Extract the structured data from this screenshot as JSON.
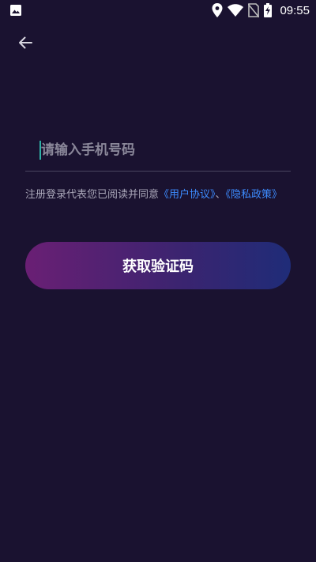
{
  "status_bar": {
    "time": "09:55",
    "icons": [
      "image-icon",
      "location-icon",
      "wifi-icon",
      "no-sim-icon",
      "battery-charging-icon"
    ]
  },
  "header": {
    "back_icon": "arrow-left-icon"
  },
  "form": {
    "phone_placeholder": "请输入手机号码",
    "phone_value": ""
  },
  "agreement": {
    "prefix": "注册登录代表您已阅读并同意",
    "user_agreement": "《用户协议》",
    "separator": "、",
    "privacy_policy": "《隐私政策》"
  },
  "actions": {
    "get_code_label": "获取验证码"
  },
  "colors": {
    "background": "#1a1230",
    "link": "#3d8cff",
    "button_gradient_start": "#6a1f74",
    "button_gradient_end": "#1f2c78",
    "caret": "#2fb0a5"
  }
}
